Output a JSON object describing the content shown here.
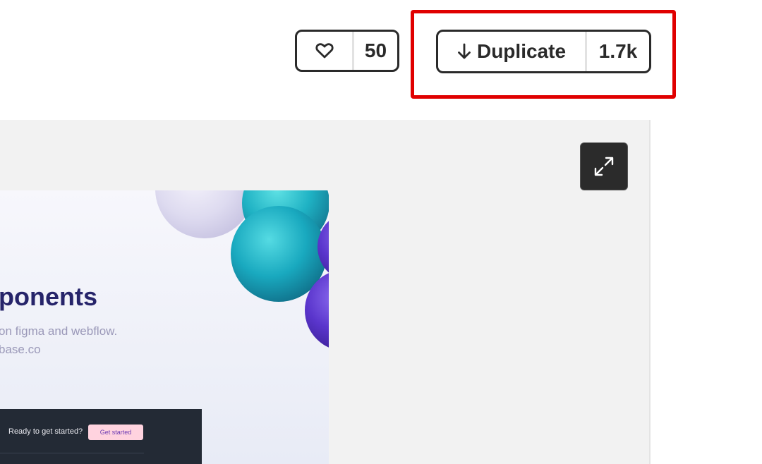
{
  "actions": {
    "like_count": "50",
    "duplicate_label": "Duplicate",
    "duplicate_count": "1.7k"
  },
  "preview": {
    "headline": "ponents",
    "subtitle_line1": "on figma and webflow.",
    "subtitle_line2": "base.co",
    "cta_text": "Ready to get started?",
    "cta_button": "Get started"
  },
  "colors": {
    "highlight": "#e00000",
    "headline": "#26246a",
    "cta_bar": "#232a35",
    "cta_button": "#ffd3df"
  }
}
